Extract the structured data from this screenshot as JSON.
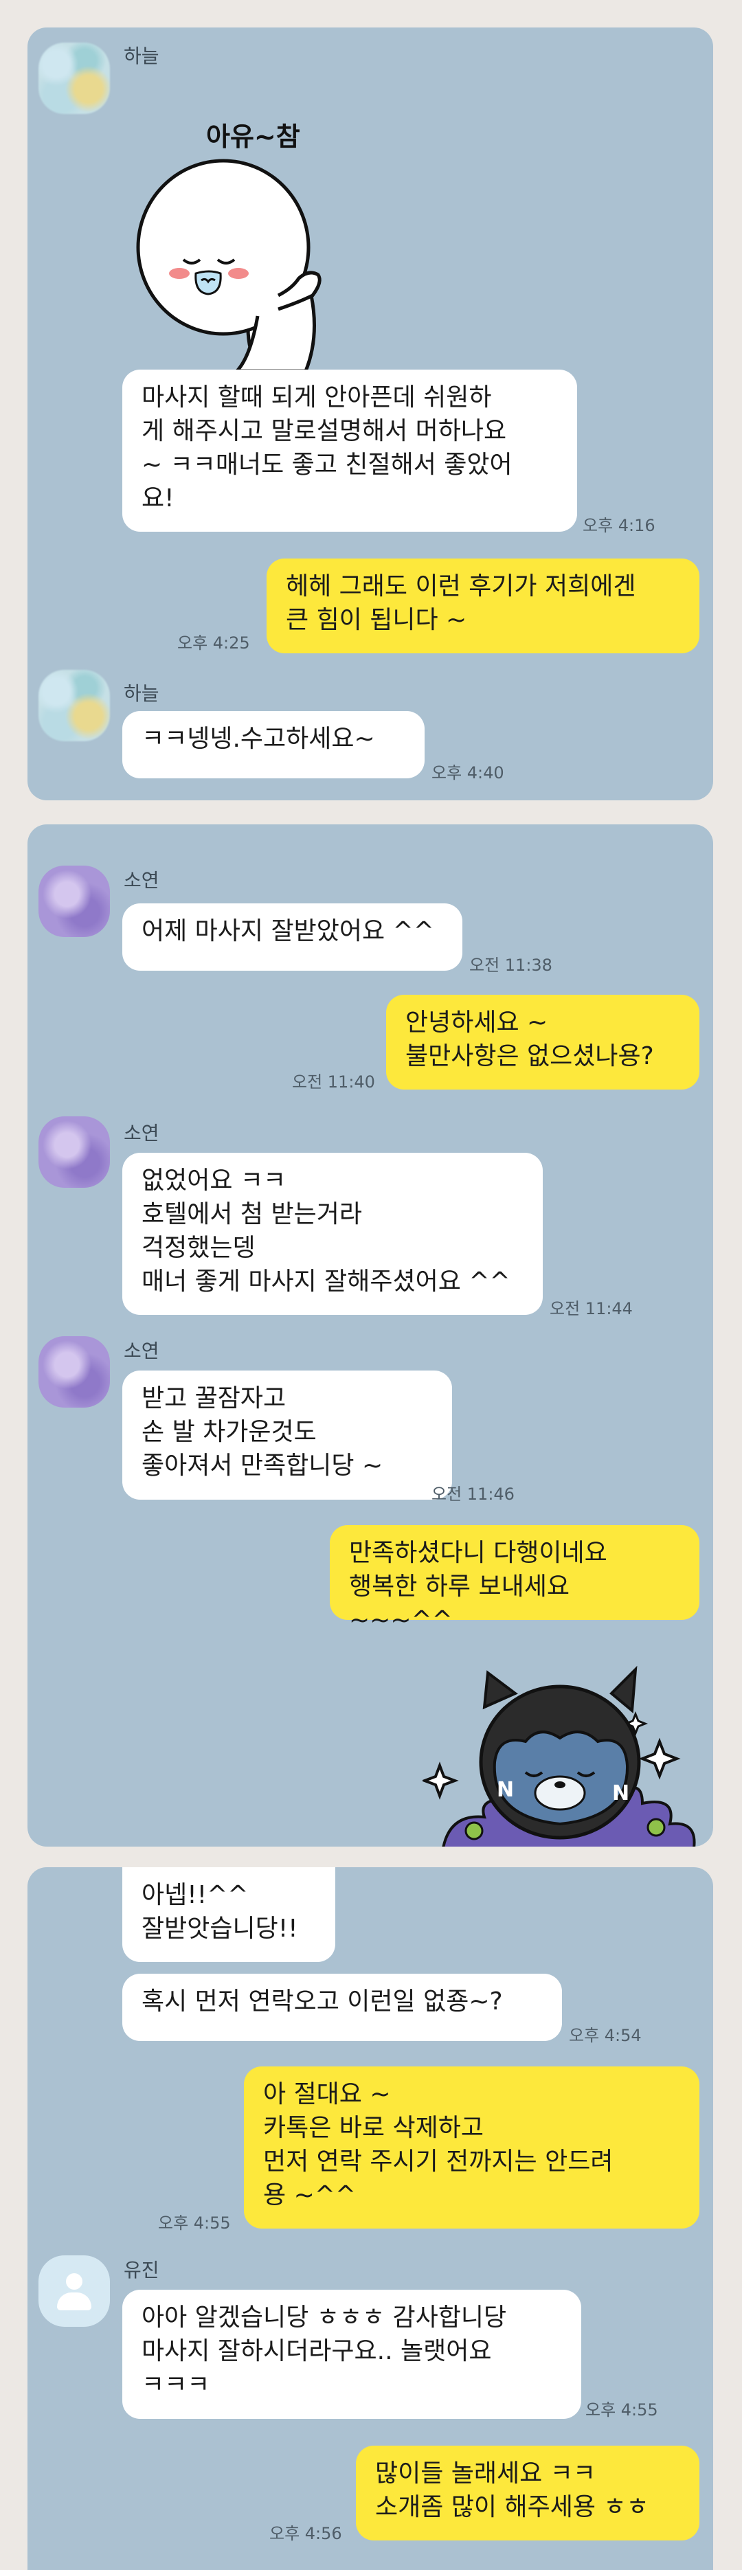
{
  "panels": [
    {
      "messages": [
        {
          "sender": "하늘",
          "type": "sticker",
          "sticker_caption": "아유~참",
          "sticker_name": "white-blob-sticker"
        },
        {
          "type": "in",
          "text": "마사지 할때 되게 안아픈데 쉬원하\n게 해주시고 말로설명해서 머하나요\n~ ㅋㅋ매너도 좋고 친절해서 좋았어\n요!",
          "time": "오후 4:16"
        },
        {
          "type": "out",
          "text": "헤헤 그래도 이런 후기가 저희에겐\n큰 힘이 됩니다 ~",
          "time": "오후 4:25"
        },
        {
          "sender": "하늘",
          "type": "in",
          "text": "ㅋㅋ넹넹.수고하세요~",
          "time": "오후 4:40"
        }
      ]
    },
    {
      "messages": [
        {
          "sender": "소연",
          "type": "in",
          "text": "어제 마사지 잘받았어요 ^^",
          "time": "오전 11:38"
        },
        {
          "type": "out",
          "text": "안녕하세요 ~\n불만사항은 없으셨나용?",
          "time": "오전 11:40"
        },
        {
          "sender": "소연",
          "type": "in",
          "text": "없었어요 ㅋㅋ\n호텔에서 첨 받는거라\n걱정했는뎅\n매너 좋게 마사지 잘해주셨어요 ^^",
          "time": "오전 11:44"
        },
        {
          "sender": "소연",
          "type": "in",
          "text": "받고 꿀잠자고\n손 발 차가운것도\n좋아져서 만족합니당 ~",
          "time": "오전 11:46"
        },
        {
          "type": "out",
          "text": "만족하셨다니 다행이네요\n행복한 하루 보내세요 ~~~^^"
        },
        {
          "type": "sticker",
          "sticker_name": "kakao-cat-sticker"
        }
      ]
    },
    {
      "messages": [
        {
          "type": "in",
          "text": "아넵!!^^\n잘받앗습니당!!"
        },
        {
          "type": "in",
          "text": "혹시 먼저 연락오고 이런일 없죵~?",
          "time": "오후 4:54"
        },
        {
          "type": "out",
          "text": "아 절대요 ~\n카톡은 바로 삭제하고\n먼저 연락 주시기 전까지는 안드려\n용 ~^^",
          "time": "오후 4:55"
        },
        {
          "sender": "유진",
          "type": "in",
          "text": "아아 알겠습니당 ㅎㅎㅎ 감사합니당\n마사지 잘하시더라구요.. 놀랫어요\nㅋㅋㅋ",
          "time": "오후 4:55"
        },
        {
          "type": "out",
          "text": "많이들 놀래세요 ㅋㅋ\n소개좀 많이 해주세용 ㅎㅎ",
          "time": "오후 4:56"
        }
      ]
    }
  ]
}
